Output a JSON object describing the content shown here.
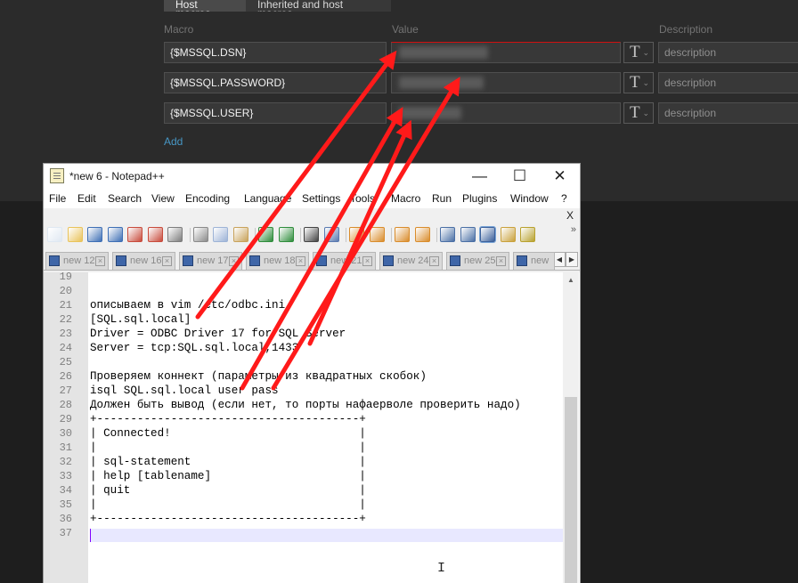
{
  "zabbix": {
    "tabs": [
      "Host macros",
      "Inherited and host macros"
    ],
    "headers": {
      "macro": "Macro",
      "value": "Value",
      "description": "Description"
    },
    "macros": [
      {
        "name": "{$MSSQL.DSN}",
        "type_symbol": "T",
        "description_placeholder": "description"
      },
      {
        "name": "{$MSSQL.PASSWORD}",
        "type_symbol": "T",
        "description_placeholder": "description"
      },
      {
        "name": "{$MSSQL.USER}",
        "type_symbol": "T",
        "description_placeholder": "description"
      }
    ],
    "add_label": "Add"
  },
  "notepad": {
    "title": "*new 6 - Notepad++",
    "window_controls": {
      "minimize": "—",
      "maximize": "☐",
      "close": "✕"
    },
    "menu": [
      "File",
      "Edit",
      "Search",
      "View",
      "Encoding",
      "Language",
      "Settings",
      "Tools",
      "Macro",
      "Run",
      "Plugins",
      "Window",
      "?"
    ],
    "menu_close": "X",
    "tabs": [
      "new 12",
      "new 16",
      "new 17",
      "new 18",
      "new 21",
      "new 24",
      "new 25",
      "new"
    ],
    "line_numbers": [
      "19",
      "20",
      "21",
      "22",
      "23",
      "24",
      "25",
      "26",
      "27",
      "28",
      "29",
      "30",
      "31",
      "32",
      "33",
      "34",
      "35",
      "36",
      "37"
    ],
    "lines": [
      "",
      "",
      "описываем в vim /etc/odbc.ini",
      "[SQL.sql.local]",
      "Driver = ODBC Driver 17 for SQL Server",
      "Server = tcp:SQL.sql.local,1433",
      "",
      "Проверяем коннект (параметры из квадратных скобок)",
      "isql SQL.sql.local user pass",
      "Должен быть вывод (если нет, то порты нафаерволе проверить надо)",
      "+---------------------------------------+",
      "| Connected!                            |",
      "|                                       |",
      "| sql-statement                         |",
      "| help [tablename]                      |",
      "| quit                                  |",
      "|                                       |",
      "+---------------------------------------+",
      ""
    ]
  },
  "colors": {
    "arrow": "#ff1a1a",
    "zabbix_bg": "#2b2b2b",
    "link": "#4796c4",
    "current_line": "#e8e8ff"
  }
}
